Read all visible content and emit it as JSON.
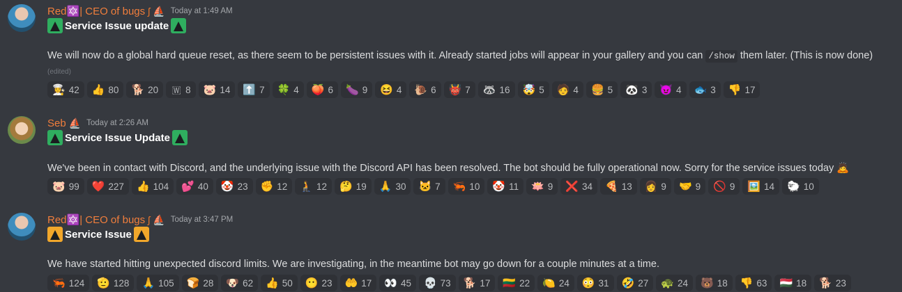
{
  "messages": [
    {
      "author": "Red🔯| CEO of bugs",
      "author_icons": [
        "sail-icon",
        "boat-icon"
      ],
      "timestamp": "Today at 1:49 AM",
      "title": "Service Issue update",
      "title_badge": "green",
      "text_before_code": "We will now do a global hard queue reset, as there seem to be persistent issues with it. Already started jobs will appear in your gallery and you can",
      "code": "/show",
      "text_after_code": "them later. (This is now done)",
      "edited": "(edited)",
      "reactions": [
        {
          "emoji": "👩‍🍳",
          "count": "42"
        },
        {
          "emoji": "👍",
          "count": "80"
        },
        {
          "emoji": "🐕",
          "count": "20"
        },
        {
          "emoji": "🇼",
          "count": "8"
        },
        {
          "emoji": "🐷",
          "count": "14"
        },
        {
          "emoji": "⬆️",
          "count": "7"
        },
        {
          "emoji": "🍀",
          "count": "4"
        },
        {
          "emoji": "🍑",
          "count": "6"
        },
        {
          "emoji": "🍆",
          "count": "9"
        },
        {
          "emoji": "😆",
          "count": "4"
        },
        {
          "emoji": "🐌",
          "count": "6"
        },
        {
          "emoji": "👹",
          "count": "7"
        },
        {
          "emoji": "🦝",
          "count": "16"
        },
        {
          "emoji": "🤯",
          "count": "5"
        },
        {
          "emoji": "🧑",
          "count": "4"
        },
        {
          "emoji": "🍔",
          "count": "5"
        },
        {
          "emoji": "🐼",
          "count": "3"
        },
        {
          "emoji": "😈",
          "count": "4"
        },
        {
          "emoji": "🐟",
          "count": "3"
        },
        {
          "emoji": "👎",
          "count": "17"
        }
      ]
    },
    {
      "author": "Seb",
      "author_icons": [
        "boat-icon"
      ],
      "timestamp": "Today at 2:26 AM",
      "title": "Service Issue Update",
      "title_badge": "green",
      "text": "We've been in contact with Discord, and the underlying issue with the Discord API has been resolved. The bot should be fully operational now. Sorry for the service issues today 🙇",
      "reactions": [
        {
          "emoji": "🐷",
          "count": "99"
        },
        {
          "emoji": "❤️",
          "count": "227"
        },
        {
          "emoji": "👍",
          "count": "104"
        },
        {
          "emoji": "💕",
          "count": "40"
        },
        {
          "emoji": "🤡",
          "count": "23"
        },
        {
          "emoji": "✊",
          "count": "12"
        },
        {
          "emoji": "🧎",
          "count": "12"
        },
        {
          "emoji": "🤔",
          "count": "19"
        },
        {
          "emoji": "🙏",
          "count": "30"
        },
        {
          "emoji": "🐱",
          "count": "7"
        },
        {
          "emoji": "🦐",
          "count": "10"
        },
        {
          "emoji": "🤡",
          "count": "11"
        },
        {
          "emoji": "🪷",
          "count": "9"
        },
        {
          "emoji": "❌",
          "count": "34"
        },
        {
          "emoji": "🍕",
          "count": "13"
        },
        {
          "emoji": "👩",
          "count": "9"
        },
        {
          "emoji": "🤝",
          "count": "9"
        },
        {
          "emoji": "🚫",
          "count": "9"
        },
        {
          "emoji": "🖼️",
          "count": "14"
        },
        {
          "emoji": "🐑",
          "count": "10"
        }
      ]
    },
    {
      "author": "Red🔯| CEO of bugs",
      "author_icons": [
        "sail-icon",
        "boat-icon"
      ],
      "timestamp": "Today at 3:47 PM",
      "title": "Service Issue",
      "title_badge": "orange",
      "text": "We have started hitting unexpected discord limits. We are investigating, in the meantime bot may go down for a couple minutes at a time.",
      "reactions": [
        {
          "emoji": "🦐",
          "count": "124"
        },
        {
          "emoji": "🫡",
          "count": "128"
        },
        {
          "emoji": "🙏",
          "count": "105"
        },
        {
          "emoji": "🍞",
          "count": "28"
        },
        {
          "emoji": "🐶",
          "count": "62"
        },
        {
          "emoji": "👍",
          "count": "50"
        },
        {
          "emoji": "😶",
          "count": "23"
        },
        {
          "emoji": "🤲",
          "count": "17"
        },
        {
          "emoji": "👀",
          "count": "45"
        },
        {
          "emoji": "💀",
          "count": "73"
        },
        {
          "emoji": "🐕",
          "count": "17"
        },
        {
          "emoji": "🇱🇹",
          "count": "22"
        },
        {
          "emoji": "🍋",
          "count": "24"
        },
        {
          "emoji": "😳",
          "count": "31"
        },
        {
          "emoji": "🤣",
          "count": "27"
        },
        {
          "emoji": "🐢",
          "count": "24"
        },
        {
          "emoji": "🐻",
          "count": "18"
        },
        {
          "emoji": "👎",
          "count": "63"
        },
        {
          "emoji": "🇭🇺",
          "count": "18"
        },
        {
          "emoji": "🐕",
          "count": "23"
        }
      ]
    }
  ]
}
